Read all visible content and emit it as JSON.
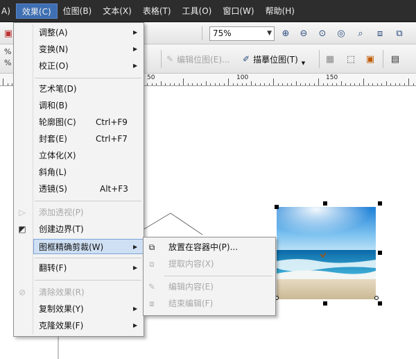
{
  "menubar": {
    "items": [
      {
        "label": "A)"
      },
      {
        "label": "效果(C)"
      },
      {
        "label": "位图(B)"
      },
      {
        "label": "文本(X)"
      },
      {
        "label": "表格(T)"
      },
      {
        "label": "工具(O)"
      },
      {
        "label": "窗口(W)"
      },
      {
        "label": "帮助(H)"
      }
    ]
  },
  "toolbar": {
    "zoom_value": "75%",
    "edit_bitmap_label": "编辑位图(E)...",
    "trace_bitmap_label": "描摹位图(T)",
    "left_glyphs": [
      "%",
      "%"
    ]
  },
  "ruler": {
    "labels": [
      "50",
      "100",
      "150"
    ]
  },
  "effects_menu": {
    "items": [
      {
        "label": "调整(A)"
      },
      {
        "label": "变换(N)"
      },
      {
        "label": "校正(O)"
      },
      {
        "label": "艺术笔(D)"
      },
      {
        "label": "调和(B)"
      },
      {
        "label": "轮廓图(C)",
        "shortcut": "Ctrl+F9"
      },
      {
        "label": "封套(E)",
        "shortcut": "Ctrl+F7"
      },
      {
        "label": "立体化(X)"
      },
      {
        "label": "斜角(L)"
      },
      {
        "label": "透镜(S)",
        "shortcut": "Alt+F3"
      },
      {
        "label": "添加透视(P)"
      },
      {
        "label": "创建边界(T)"
      },
      {
        "label": "图框精确剪裁(W)"
      },
      {
        "label": "翻转(F)"
      },
      {
        "label": "清除效果(R)"
      },
      {
        "label": "复制效果(Y)"
      },
      {
        "label": "克隆效果(F)"
      }
    ]
  },
  "powerclip_submenu": {
    "items": [
      {
        "label": "放置在容器中(P)..."
      },
      {
        "label": "提取内容(X)"
      },
      {
        "label": "编辑内容(E)"
      },
      {
        "label": "结束编辑(F)"
      }
    ]
  },
  "colors": {
    "menubar_bg": "#2d2d2d",
    "menu_highlight": "#cfe0f4",
    "active_menu": "#3e6fb3"
  }
}
